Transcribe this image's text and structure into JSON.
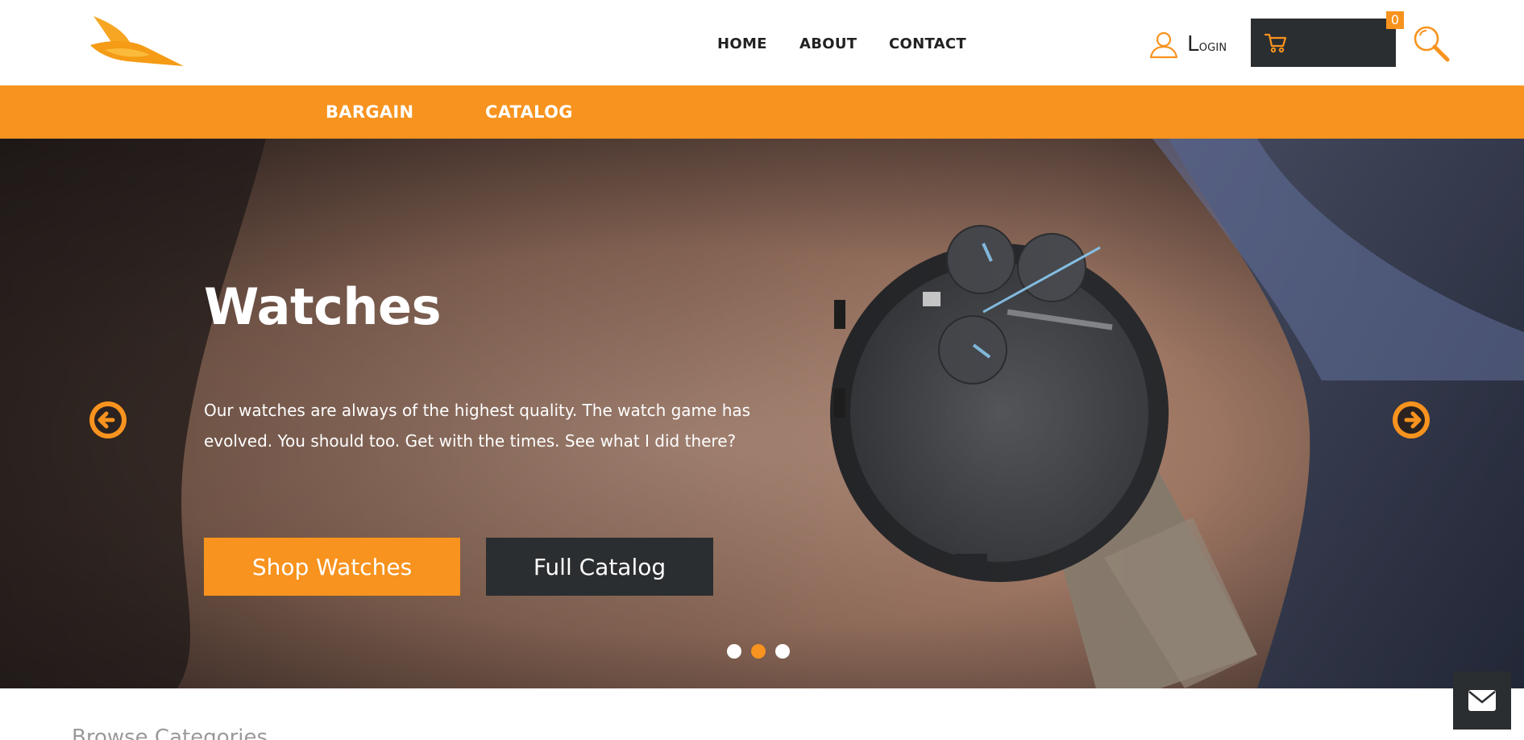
{
  "brand": {
    "logo_icon": "bird-wing-logo",
    "accent_color": "#f7931e",
    "dark_color": "#2b2e30"
  },
  "nav": {
    "home": "HOME",
    "about": "ABOUT",
    "contact": "CONTACT"
  },
  "account": {
    "login_label": "Login",
    "login_icon": "user-icon"
  },
  "cart": {
    "icon": "cart-icon",
    "count": "0"
  },
  "search": {
    "icon": "search-icon"
  },
  "subnav": {
    "bargain": "BARGAIN",
    "catalog": "CATALOG"
  },
  "hero": {
    "title": "Watches",
    "text": "Our watches are always of the highest quality. The watch game has evolved. You should too. Get with the times. See what I did there?",
    "primary_button": "Shop Watches",
    "secondary_button": "Full Catalog",
    "prev_icon": "arrow-left-circle-icon",
    "next_icon": "arrow-right-circle-icon",
    "slides": 3,
    "active_slide": 2
  },
  "section": {
    "browse_title": "Browse Categories"
  },
  "contact_widget": {
    "icon": "envelope-icon"
  }
}
